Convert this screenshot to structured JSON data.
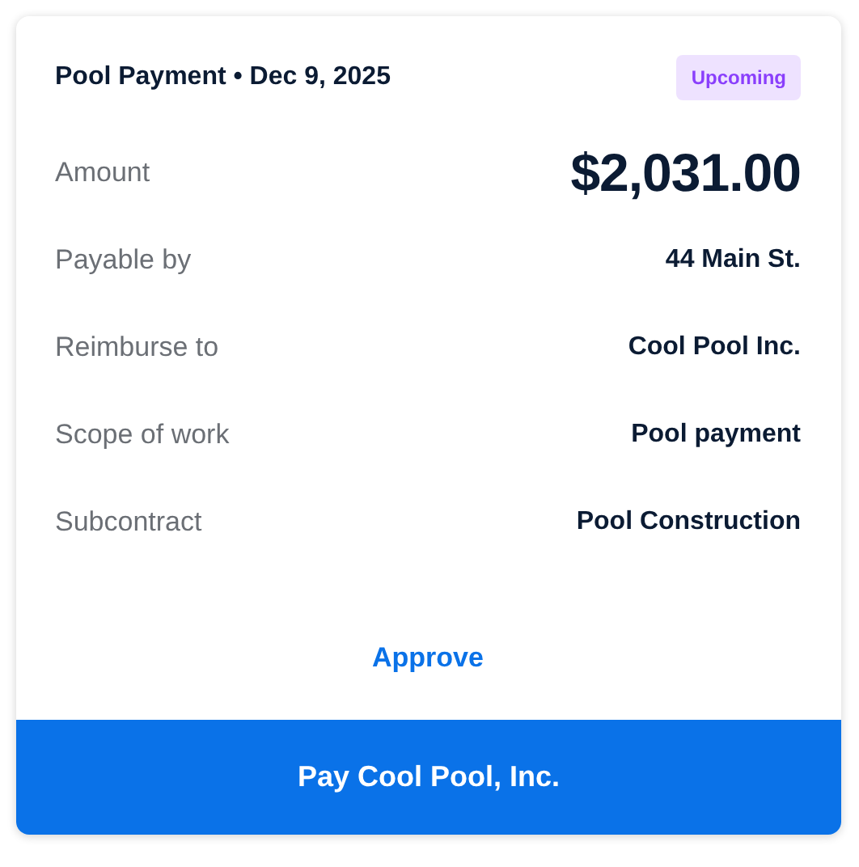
{
  "card": {
    "title": "Pool Payment • Dec 9, 2025",
    "badge": {
      "label": "Upcoming",
      "color": "#8a3ffc"
    },
    "rows": [
      {
        "kind": "amount",
        "label": "Amount",
        "value": "$2,031.00"
      },
      {
        "kind": "detail",
        "label": "Payable by",
        "value": "44 Main St."
      },
      {
        "kind": "detail",
        "label": "Reimburse to",
        "value": "Cool Pool Inc."
      },
      {
        "kind": "detail",
        "label": "Scope of work",
        "value": "Pool payment"
      },
      {
        "kind": "detail",
        "label": "Subcontract",
        "value": "Pool Construction"
      }
    ],
    "approve": "Approve",
    "pay_button": "Pay Cool Pool, Inc."
  }
}
